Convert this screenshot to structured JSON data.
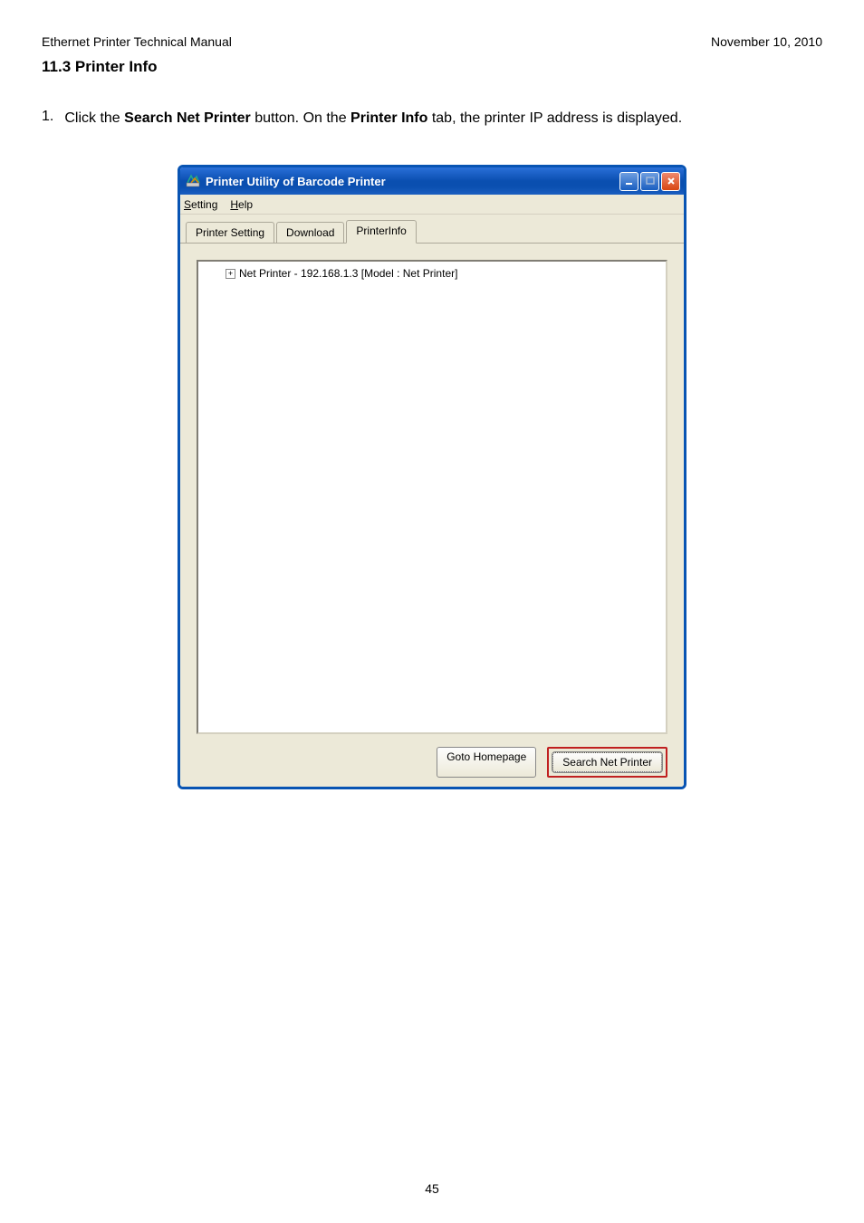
{
  "header": {
    "left": "Ethernet Printer Technical Manual",
    "right": "November 10, 2010"
  },
  "section_heading": "11.3 Printer Info",
  "instruction": {
    "number": "1.",
    "pre": "Click the ",
    "b1": "Search Net Printer",
    "mid": " button. On the ",
    "b2": "Printer Info",
    "post": " tab, the printer IP address is displayed."
  },
  "window": {
    "title": "Printer Utility of Barcode Printer",
    "menu": {
      "setting": "Setting",
      "help": "Help"
    },
    "tabs": {
      "printer_setting": "Printer Setting",
      "download": "Download",
      "printerinfo": "PrinterInfo"
    },
    "tree_item": "Net Printer - 192.168.1.3 [Model : Net Printer]",
    "buttons": {
      "goto": "Goto Homepage",
      "search": "Search Net Printer"
    }
  },
  "page_number": "45"
}
